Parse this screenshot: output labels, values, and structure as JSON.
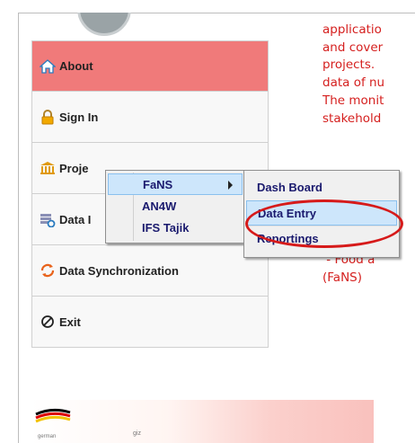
{
  "sidebar": {
    "items": [
      {
        "label": "About",
        "icon": "home-icon",
        "active": true
      },
      {
        "label": "Sign In",
        "icon": "lock-icon"
      },
      {
        "label": "Proje",
        "icon": "bank-icon"
      },
      {
        "label": "Data I",
        "icon": "data-icon"
      },
      {
        "label": "Data Synchronization",
        "icon": "sync-icon"
      },
      {
        "label": "Exit",
        "icon": "exit-icon"
      }
    ]
  },
  "projects_menu": {
    "items": [
      {
        "label": "FaNS",
        "has_submenu": true,
        "highlighted": true
      },
      {
        "label": "AN4W"
      },
      {
        "label": "IFS Tajik"
      }
    ]
  },
  "fans_submenu": {
    "items": [
      {
        "label": "Dash Board"
      },
      {
        "label": "Data Entry",
        "highlighted": true
      },
      {
        "label": "Reportings"
      }
    ]
  },
  "content": {
    "text": "applicatio\nand cover\nprojects. \ndata of nu\nThe monit\nstakehold\n\n\n\n\nthe softw\nof the fo\n\n - Food a\n(FaNS)"
  },
  "footer": {
    "logo_text_1": "german",
    "logo_text_2": "giz"
  },
  "colors": {
    "active_item": "#f07a7a",
    "content_text": "#d5201f",
    "annotation": "#d61a1a",
    "menu_highlight": "#cde6fb"
  }
}
